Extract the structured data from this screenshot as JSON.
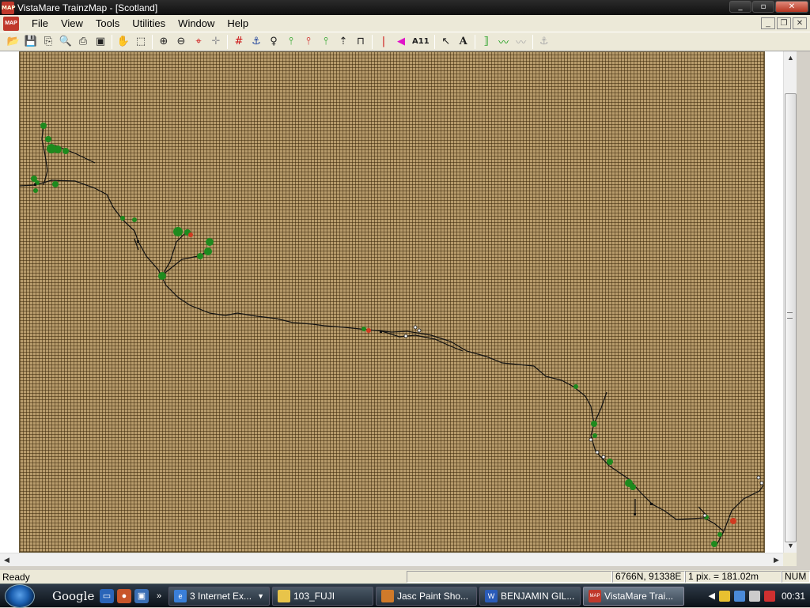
{
  "window": {
    "title": "VistaMare TrainzMap - [Scotland]",
    "app_icon_text": "MAP"
  },
  "menu": {
    "items": [
      "File",
      "View",
      "Tools",
      "Utilities",
      "Window",
      "Help"
    ]
  },
  "toolbar": {
    "label_text": "A11",
    "tools": [
      "open-icon",
      "save-icon",
      "export-icon",
      "print-preview-icon",
      "print-icon",
      "layers-icon",
      "pan-hand-icon",
      "select-rect-icon",
      "zoom-in-icon",
      "zoom-out-icon",
      "center-icon",
      "crosshair-icon",
      "grid-icon",
      "anchor-icon",
      "marker-icon",
      "green-track-icon",
      "red-track-icon",
      "green-track-alt-icon",
      "junction-icon",
      "bridge-icon",
      "red-bar-icon",
      "speaker-icon",
      "label-icon",
      "pointer-icon",
      "text-icon",
      "bracket-icon",
      "green-line-icon",
      "grey-line-icon",
      "grey-anchor-icon"
    ]
  },
  "statusbar": {
    "status": "Ready",
    "coordinates": "6766N, 91338E",
    "scale": "1 pix. = 181.02m",
    "num": "NUM"
  },
  "taskbar": {
    "search_label": "Google",
    "tasks": [
      {
        "label": "3 Internet Ex...",
        "icon": "ie-icon",
        "color": "#3a7fd8"
      },
      {
        "label": "103_FUJI",
        "icon": "folder-icon",
        "color": "#e8c44a"
      },
      {
        "label": "Jasc Paint Sho...",
        "icon": "paint-icon",
        "color": "#d07a2a"
      },
      {
        "label": "BENJAMIN GIL...",
        "icon": "word-icon",
        "color": "#2a5bb8"
      },
      {
        "label": "VistaMare Trai...",
        "icon": "trainzmap-icon",
        "color": "#c0392b"
      }
    ],
    "clock": "00:31"
  },
  "colors": {
    "map_background": "#b89c6c",
    "track": "#111111",
    "station": "#1e8a1e",
    "highlight": "#d03a20"
  }
}
